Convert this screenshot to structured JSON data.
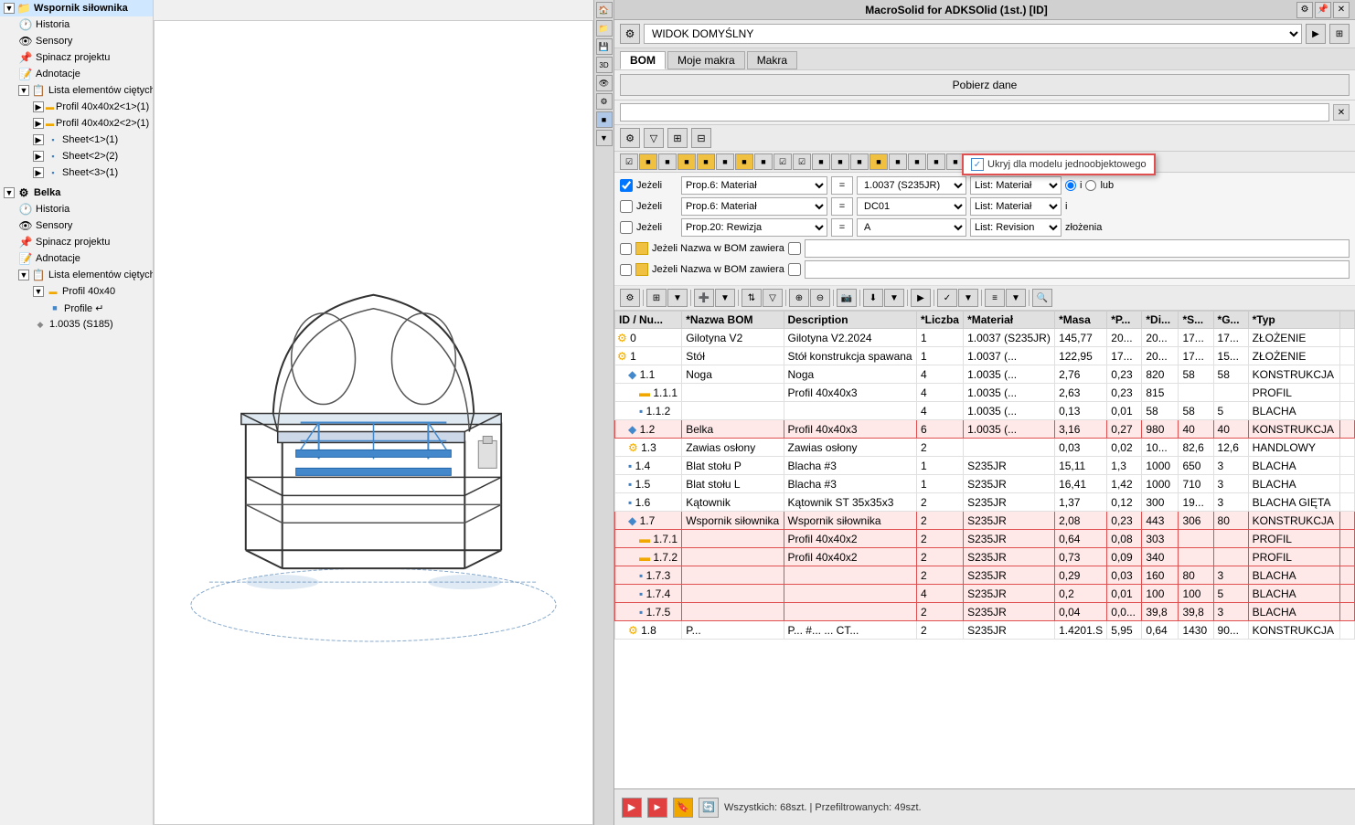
{
  "app": {
    "title": "MacroSolid for ADKSOlid (1st.) [ID]",
    "left_panel_title": "Wspornik siłownika"
  },
  "tree": {
    "sections": [
      {
        "id": "wspornik",
        "label": "Wspornik siłownika",
        "expanded": true,
        "indent": 0,
        "type": "root"
      },
      {
        "id": "historia1",
        "label": "Historia",
        "indent": 1,
        "type": "history"
      },
      {
        "id": "sensory1",
        "label": "Sensory",
        "indent": 1,
        "type": "sensor"
      },
      {
        "id": "spinacz1",
        "label": "Spinacz projektu",
        "indent": 1,
        "type": "clip"
      },
      {
        "id": "adnotacje1",
        "label": "Adnotacje",
        "indent": 1,
        "type": "note"
      },
      {
        "id": "lista1",
        "label": "Lista elementów ciętych",
        "indent": 1,
        "type": "list",
        "expanded": true
      },
      {
        "id": "profil1",
        "label": "Profil 40x40x2<1>(1)",
        "indent": 2,
        "type": "profil"
      },
      {
        "id": "profil2",
        "label": "Profil 40x40x2<2>(1)",
        "indent": 2,
        "type": "profil"
      },
      {
        "id": "sheet1",
        "label": "Sheet<1>(1)",
        "indent": 2,
        "type": "sheet"
      },
      {
        "id": "sheet2",
        "label": "Sheet<2>(2)",
        "indent": 2,
        "type": "sheet"
      },
      {
        "id": "sheet3",
        "label": "Sheet<3>(1)",
        "indent": 2,
        "type": "sheet"
      }
    ],
    "sections2": [
      {
        "id": "belka",
        "label": "Belka",
        "expanded": true,
        "indent": 0,
        "type": "root"
      },
      {
        "id": "historia2",
        "label": "Historia",
        "indent": 1,
        "type": "history"
      },
      {
        "id": "sensory2",
        "label": "Sensory",
        "indent": 1,
        "type": "sensor"
      },
      {
        "id": "spinacz2",
        "label": "Spinacz projektu",
        "indent": 1,
        "type": "clip"
      },
      {
        "id": "adnotacje2",
        "label": "Adnotacje",
        "indent": 1,
        "type": "note"
      },
      {
        "id": "lista2",
        "label": "Lista elementów ciętych",
        "indent": 1,
        "type": "list",
        "expanded": true
      },
      {
        "id": "profil3",
        "label": "Profil 40x40",
        "indent": 2,
        "type": "profil"
      },
      {
        "id": "profile4",
        "label": "Profile ↵",
        "indent": 3,
        "type": "profil"
      },
      {
        "id": "mat1",
        "label": "1.0035 (S185)",
        "indent": 2,
        "type": "material"
      }
    ]
  },
  "right_panel": {
    "title": "MacroSolid for ADKSOlid (1st.) [ID]",
    "view_select": "WIDOK DOMYŚLNY",
    "tabs": [
      "BOM",
      "Moje makra",
      "Makra"
    ],
    "active_tab": "BOM",
    "fetch_button": "Pobierz dane",
    "ukryj_label": "Ukryj dla modelu jednoobjektowego"
  },
  "filters": [
    {
      "id": "f1",
      "enabled": true,
      "label": "Jeżeli",
      "prop": "Prop.6: Materiał",
      "op": "=",
      "value": "1.0037 (S235JR)",
      "list": "List: Materiał",
      "radio": "i"
    },
    {
      "id": "f2",
      "enabled": false,
      "label": "Jeżeli",
      "prop": "Prop.6: Materiał",
      "op": "=",
      "value": "DC01",
      "list": "List: Materiał",
      "radio": "i"
    },
    {
      "id": "f3",
      "enabled": false,
      "label": "Jeżeli",
      "prop": "Prop.20: Rewizja",
      "op": "=",
      "value": "A",
      "list": "List: Revision",
      "extra": "złożenia"
    }
  ],
  "bom_rows": [
    {
      "id": "0",
      "icon": "assembly",
      "nazwa": "Gilotyna V2",
      "desc": "Gilotyna V2.2024",
      "liczba": "1",
      "material": "1.0037 (S235JR)",
      "masa": "145,77",
      "p": "20...",
      "di": "20...",
      "s": "17...",
      "g": "17...",
      "typ": "ZŁOŻENIE",
      "highlight": false
    },
    {
      "id": "1",
      "icon": "assembly",
      "nazwa": "Stół",
      "desc": "Stół konstrukcja spawana",
      "liczba": "1",
      "material": "1.0037 (...",
      "masa": "122,95",
      "p": "17...",
      "di": "20...",
      "s": "17...",
      "g": "15...",
      "typ": "ZŁOŻENIE",
      "highlight": false
    },
    {
      "id": "1.1",
      "icon": "part",
      "nazwa": "Noga",
      "desc": "Noga",
      "liczba": "4",
      "material": "1.0035 (...",
      "masa": "2,76",
      "p": "0,23",
      "di": "820",
      "s": "58",
      "g": "58",
      "typ": "KONSTRUKCJA",
      "highlight": false
    },
    {
      "id": "1.1.1",
      "icon": "profil",
      "nazwa": "",
      "desc": "Profil 40x40x3",
      "liczba": "4",
      "material": "1.0035 (...",
      "masa": "2,63",
      "p": "0,23",
      "di": "815",
      "s": "",
      "g": "",
      "typ": "PROFIL",
      "highlight": false
    },
    {
      "id": "1.1.2",
      "icon": "sheet",
      "nazwa": "",
      "desc": "",
      "liczba": "4",
      "material": "1.0035 (...",
      "masa": "0,13",
      "p": "0,01",
      "di": "58",
      "s": "58",
      "g": "5",
      "typ": "BLACHA",
      "highlight": false
    },
    {
      "id": "1.2",
      "icon": "part",
      "nazwa": "Belka",
      "desc": "Profil 40x40x3",
      "liczba": "6",
      "material": "1.0035 (...",
      "masa": "3,16",
      "p": "0,27",
      "di": "980",
      "s": "40",
      "g": "40",
      "typ": "KONSTRUKCJA",
      "highlight": true
    },
    {
      "id": "1.3",
      "icon": "assembly",
      "nazwa": "Zawias osłony",
      "desc": "Zawias osłony",
      "liczba": "2",
      "material": "",
      "masa": "0,03",
      "p": "0,02",
      "di": "10...",
      "s": "82,6",
      "g": "12,6",
      "typ": "HANDLOWY",
      "highlight": false
    },
    {
      "id": "1.4",
      "icon": "sheet",
      "nazwa": "Blat stołu P",
      "desc": "Blacha #3",
      "liczba": "1",
      "material": "S235JR",
      "masa": "15,11",
      "p": "1,3",
      "di": "1000",
      "s": "650",
      "g": "3",
      "typ": "BLACHA",
      "highlight": false
    },
    {
      "id": "1.5",
      "icon": "sheet",
      "nazwa": "Blat stołu L",
      "desc": "Blacha #3",
      "liczba": "1",
      "material": "S235JR",
      "masa": "16,41",
      "p": "1,42",
      "di": "1000",
      "s": "710",
      "g": "3",
      "typ": "BLACHA",
      "highlight": false
    },
    {
      "id": "1.6",
      "icon": "sheet",
      "nazwa": "Kątownik",
      "desc": "Kątownik ST 35x35x3",
      "liczba": "2",
      "material": "S235JR",
      "masa": "1,37",
      "p": "0,12",
      "di": "300",
      "s": "19...",
      "g": "3",
      "typ": "BLACHA GIĘTA",
      "highlight": false
    },
    {
      "id": "1.7",
      "icon": "part",
      "nazwa": "Wspornik siłownika",
      "desc": "Wspornik siłownika",
      "liczba": "2",
      "material": "S235JR",
      "masa": "2,08",
      "p": "0,23",
      "di": "443",
      "s": "306",
      "g": "80",
      "typ": "KONSTRUKCJA",
      "highlight": true
    },
    {
      "id": "1.7.1",
      "icon": "profil",
      "nazwa": "",
      "desc": "Profil 40x40x2",
      "liczba": "2",
      "material": "S235JR",
      "masa": "0,64",
      "p": "0,08",
      "di": "303",
      "s": "",
      "g": "",
      "typ": "PROFIL",
      "highlight": true
    },
    {
      "id": "1.7.2",
      "icon": "profil",
      "nazwa": "",
      "desc": "Profil 40x40x2",
      "liczba": "2",
      "material": "S235JR",
      "masa": "0,73",
      "p": "0,09",
      "di": "340",
      "s": "",
      "g": "",
      "typ": "PROFIL",
      "highlight": true
    },
    {
      "id": "1.7.3",
      "icon": "sheet",
      "nazwa": "",
      "desc": "",
      "liczba": "2",
      "material": "S235JR",
      "masa": "0,29",
      "p": "0,03",
      "di": "160",
      "s": "80",
      "g": "3",
      "typ": "BLACHA",
      "highlight": true
    },
    {
      "id": "1.7.4",
      "icon": "sheet",
      "nazwa": "",
      "desc": "",
      "liczba": "4",
      "material": "S235JR",
      "masa": "0,2",
      "p": "0,01",
      "di": "100",
      "s": "100",
      "g": "5",
      "typ": "BLACHA",
      "highlight": true
    },
    {
      "id": "1.7.5",
      "icon": "sheet",
      "nazwa": "",
      "desc": "",
      "liczba": "2",
      "material": "S235JR",
      "masa": "0,04",
      "p": "0,0...",
      "di": "39,8",
      "s": "39,8",
      "g": "3",
      "typ": "BLACHA",
      "highlight": true
    },
    {
      "id": "1.8",
      "icon": "assembly",
      "nazwa": "P...",
      "desc": "P... #... ... CT...",
      "liczba": "2",
      "material": "S235JR",
      "masa": "1.4201.S",
      "p": "5,95",
      "di": "0,64",
      "s": "1430",
      "g": "90...",
      "typ": "KONSTRUKCJA",
      "highlight": false
    }
  ],
  "table_headers": [
    "ID / Nu...",
    "*Nazwa BOM",
    "Description",
    "*Liczba",
    "*Materiał",
    "*Masa",
    "*P...",
    "*Di...",
    "*S...",
    "*G...",
    "*Typ"
  ],
  "bottom_status": "Wszystkich: 68szt. | Przefiltrowanych: 49szt.",
  "colors": {
    "highlight_red": "#ffe8e8",
    "highlight_border": "#e05050",
    "header_bg": "#e0e0e0",
    "accent_blue": "#4080c0"
  }
}
